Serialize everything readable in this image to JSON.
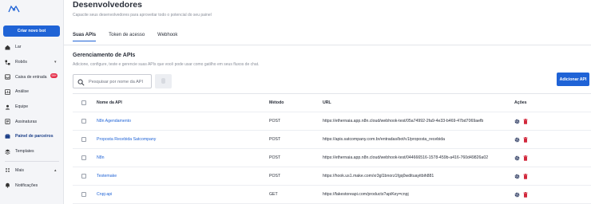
{
  "sidebar": {
    "logo": "bot-logo",
    "new_bot_label": "Criar novo bot",
    "items": [
      {
        "label": "Lar",
        "icon": "home-icon"
      },
      {
        "label": "Robôs",
        "icon": "flow-icon",
        "caret": "▾"
      },
      {
        "label": "Caixa de entrada",
        "icon": "inbox-icon",
        "badge": "99+"
      },
      {
        "label": "Análise",
        "icon": "analytics-icon"
      },
      {
        "label": "Equipe",
        "icon": "team-icon"
      },
      {
        "label": "Assinaturas",
        "icon": "subscription-icon"
      },
      {
        "label": "Painel de parceiros",
        "icon": "partners-icon"
      },
      {
        "label": "Templates",
        "icon": "templates-icon"
      },
      {
        "label": "Mais",
        "icon": "more-icon",
        "caret": "▴"
      },
      {
        "label": "Notificações",
        "icon": "bell-icon"
      }
    ]
  },
  "header": {
    "title": "Desenvolvedores",
    "subtitle": "Capacite seus desenvolvedores para aproveitar todo o potencial do seu painel"
  },
  "tabs": [
    {
      "label": "Suas APIs",
      "active": true
    },
    {
      "label": "Token de acesso",
      "active": false
    },
    {
      "label": "Webhook",
      "active": false
    }
  ],
  "section": {
    "title": "Gerenciamento de APIs",
    "subtitle": "Adicione, configure, teste e gerencie suas APIs que você pode usar como gatilho em seus fluxos de chat."
  },
  "search": {
    "placeholder": "Pesquisar por nome da API",
    "value": ""
  },
  "add_api_label": "Adicionar API",
  "table": {
    "columns": [
      "Nome da API",
      "Método",
      "URL",
      "Ações"
    ],
    "rows": [
      {
        "name": "N8n Agendamento",
        "method": "POST",
        "url": "https://ethernaia.app.n8n.cloud/webhook-test/05a74992-2fa9-4e33-b469-47bd7069aefb"
      },
      {
        "name": "Proposta Recebida Satcompany",
        "method": "POST",
        "url": "https://apis.satcompany.com.br/entradas/bot/v1/proposta_recebida"
      },
      {
        "name": "N8n",
        "method": "POST",
        "url": "https://ethernaia.app.n8n.cloud/webhook-test/044666516-1578-459b-a416-760d49826a02"
      },
      {
        "name": "Testemake",
        "method": "POST",
        "url": "https://hook.us1.make.com/xr3gl1bnorz1fgq0wdituayitbih881"
      },
      {
        "name": "Cnpj-api",
        "method": "GET",
        "url": "https://fakestoreapi.com/products?apiKey=cnpj"
      }
    ]
  },
  "colors": {
    "accent": "#1f63d6",
    "danger": "#d2283c",
    "action_icon": "#1c2b55"
  }
}
